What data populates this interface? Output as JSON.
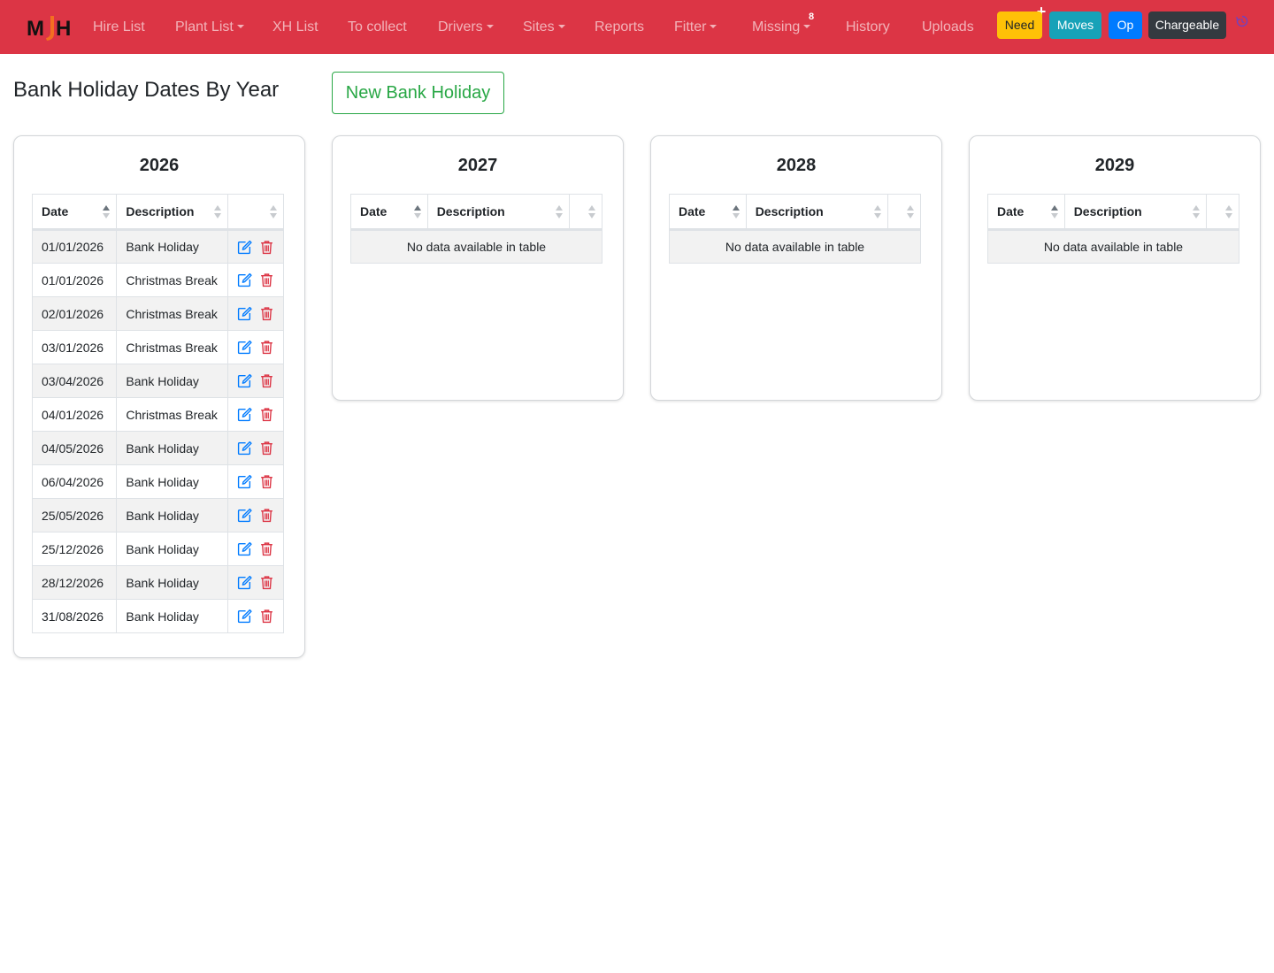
{
  "navbar": {
    "brand": "MJH",
    "items": [
      {
        "label": "Hire List",
        "dropdown": false
      },
      {
        "label": "Plant List",
        "dropdown": true
      },
      {
        "label": "XH List",
        "dropdown": false
      },
      {
        "label": "To collect",
        "dropdown": false
      },
      {
        "label": "Drivers",
        "dropdown": true
      },
      {
        "label": "Sites",
        "dropdown": true
      },
      {
        "label": "Reports",
        "dropdown": false
      },
      {
        "label": "Fitter",
        "dropdown": true
      },
      {
        "label": "Missing",
        "dropdown": true,
        "badge": "8"
      },
      {
        "label": "History",
        "dropdown": false
      },
      {
        "label": "Uploads",
        "dropdown": false
      }
    ],
    "buttons": {
      "need": "Need",
      "moves": "Moves",
      "op": "Op",
      "chargeable": "Chargeable"
    },
    "icons": [
      "plus-icon",
      "refresh-icon"
    ],
    "colors": {
      "navbar_bg": "#dc3545",
      "need": "#ffc107",
      "moves": "#17a2b8",
      "op": "#007bff",
      "chargeable": "#343a40"
    }
  },
  "page": {
    "title": "Bank Holiday Dates By Year",
    "new_button": "New Bank Holiday"
  },
  "table_headers": {
    "date": "Date",
    "description": "Description"
  },
  "empty_message": "No data available in table",
  "years": [
    {
      "year": "2026",
      "rows": [
        {
          "date": "01/01/2026",
          "description": "Bank Holiday"
        },
        {
          "date": "01/01/2026",
          "description": "Christmas Break"
        },
        {
          "date": "02/01/2026",
          "description": "Christmas Break"
        },
        {
          "date": "03/01/2026",
          "description": "Christmas Break"
        },
        {
          "date": "03/04/2026",
          "description": "Bank Holiday"
        },
        {
          "date": "04/01/2026",
          "description": "Christmas Break"
        },
        {
          "date": "04/05/2026",
          "description": "Bank Holiday"
        },
        {
          "date": "06/04/2026",
          "description": "Bank Holiday"
        },
        {
          "date": "25/05/2026",
          "description": "Bank Holiday"
        },
        {
          "date": "25/12/2026",
          "description": "Bank Holiday"
        },
        {
          "date": "28/12/2026",
          "description": "Bank Holiday"
        },
        {
          "date": "31/08/2026",
          "description": "Bank Holiday"
        }
      ]
    },
    {
      "year": "2027",
      "rows": []
    },
    {
      "year": "2028",
      "rows": []
    },
    {
      "year": "2029",
      "rows": []
    }
  ]
}
